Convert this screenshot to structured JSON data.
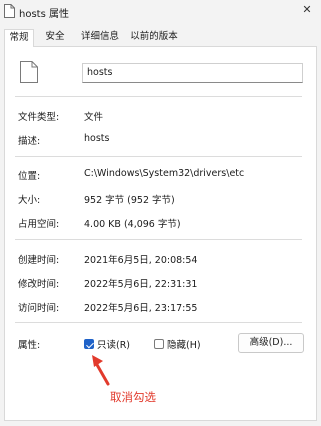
{
  "window": {
    "title": "hosts 属性",
    "close_glyph": "✕"
  },
  "tabs": [
    {
      "label": "常规",
      "active": true
    },
    {
      "label": "安全",
      "active": false
    },
    {
      "label": "详细信息",
      "active": false
    },
    {
      "label": "以前的版本",
      "active": false
    }
  ],
  "general": {
    "file_name": "hosts",
    "file_icon": "document-icon",
    "file_type_label": "文件类型:",
    "file_type_value": "文件",
    "description_label": "描述:",
    "description_value": "hosts",
    "location_label": "位置:",
    "location_value": "C:\\Windows\\System32\\drivers\\etc",
    "size_label": "大小:",
    "size_value": "952 字节 (952 字节)",
    "size_on_disk_label": "占用空间:",
    "size_on_disk_value": "4.00 KB (4,096 字节)",
    "created_label": "创建时间:",
    "created_value": "2021年6月5日, 20:08:54",
    "modified_label": "修改时间:",
    "modified_value": "2022年5月6日, 22:31:31",
    "accessed_label": "访问时间:",
    "accessed_value": "2022年5月6日, 23:17:55",
    "attributes_label": "属性:",
    "readonly_label": "只读(R)",
    "readonly_checked": true,
    "hidden_label": "隐藏(H)",
    "hidden_checked": false,
    "advanced_button": "高级(D)..."
  },
  "annotation": {
    "text": "取消勾选",
    "color": "#e23a2c"
  },
  "colors": {
    "accent": "#1f62c8",
    "background": "#f3f3f3",
    "panel": "#ffffff"
  }
}
